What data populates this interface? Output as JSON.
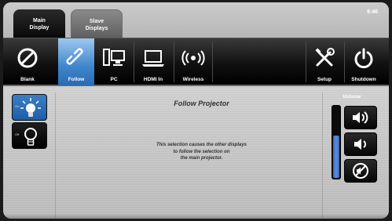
{
  "header": {
    "tabs": [
      {
        "label_line1": "Main",
        "label_line2": "Display",
        "active": true
      },
      {
        "label_line1": "Slave",
        "label_line2": "Displays",
        "active": false
      }
    ],
    "clock": "9:46"
  },
  "sources": [
    {
      "label": "Blank",
      "icon": "blank-icon",
      "active": false
    },
    {
      "label": "Follow",
      "icon": "link-icon",
      "active": true
    },
    {
      "label": "PC",
      "icon": "pc-icon",
      "active": false
    },
    {
      "label": "HDMI In",
      "icon": "laptop-icon",
      "active": false
    },
    {
      "label": "Wireless",
      "icon": "wireless-icon",
      "active": false
    }
  ],
  "utility": [
    {
      "label": "Setup",
      "icon": "tools-icon"
    },
    {
      "label": "Shutdown",
      "icon": "power-icon"
    }
  ],
  "lamp": {
    "on_label": "On",
    "off_label": "Off"
  },
  "main": {
    "title": "Follow Projector",
    "description": [
      "This selection causes the other displays",
      "to follow the selection on",
      "the main projector."
    ]
  },
  "volume": {
    "title": "Volume",
    "level": 0.6
  },
  "colors": {
    "accent": "#3f86cc",
    "volume_fill": "#4a7bd0"
  }
}
